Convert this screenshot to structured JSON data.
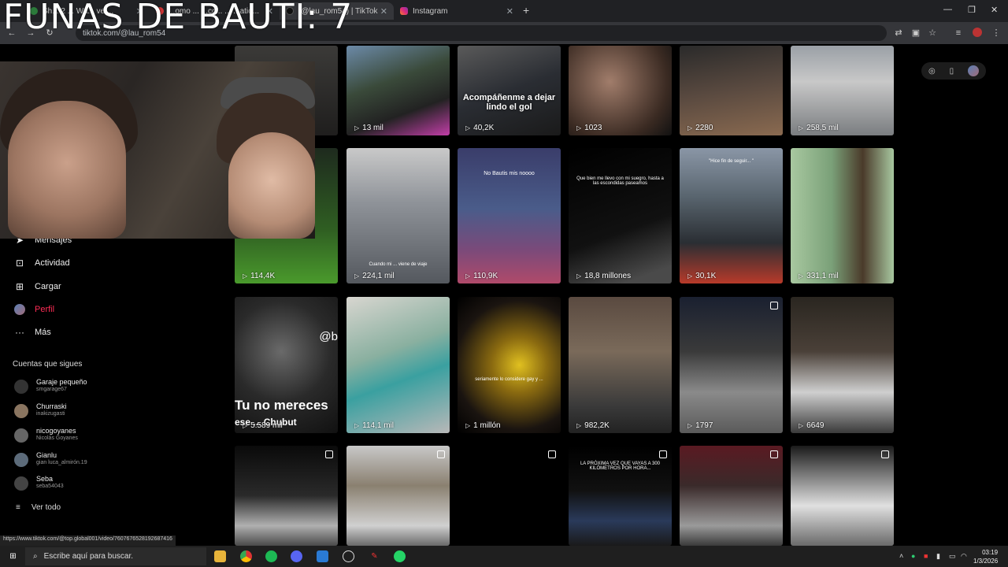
{
  "overlay": {
    "title": "FUNAS DE BAUTI: 7"
  },
  "browser": {
    "tabs": [
      {
        "label": "Sh... 2 ... Wa... ve ..."
      },
      {
        "label": "...omo ... ...cc... ... ...atio..."
      },
      {
        "label": "(@lau_rom54) | TikTok"
      },
      {
        "label": "Instagram"
      }
    ],
    "url": "tiktok.com/@lau_rom54",
    "new_tab": "+"
  },
  "sidebar": {
    "items": [
      {
        "label": "Mensajes",
        "icon": "send-icon"
      },
      {
        "label": "Actividad",
        "icon": "inbox-icon"
      },
      {
        "label": "Cargar",
        "icon": "upload-icon"
      },
      {
        "label": "Perfil",
        "icon": "profile-avatar"
      },
      {
        "label": "Más",
        "icon": "more-icon"
      }
    ],
    "following_title": "Cuentas que sigues",
    "following": [
      {
        "name": "Garaje pequeño",
        "handle": "smgarage67"
      },
      {
        "name": "Churraski",
        "handle": "inakizugasti"
      },
      {
        "name": "nicogoyanes",
        "handle": "Nicolás Goyanes"
      },
      {
        "name": "Gianlu",
        "handle": "gian luca_almirón.19"
      },
      {
        "name": "Seba",
        "handle": "seba54043"
      }
    ],
    "see_all": "Ver todo"
  },
  "grid": {
    "row1": [
      {
        "count": ""
      },
      {
        "count": "13 mil"
      },
      {
        "count": "40,2K",
        "caption": "Acompáñenme a dejar lindo el gol"
      },
      {
        "count": "1023"
      },
      {
        "count": "2280"
      },
      {
        "count": "258,5 mil"
      }
    ],
    "row2": [
      {
        "count": "114,4K"
      },
      {
        "count": "224,1 mil",
        "caption": "Cuando mi ... viene de viaje"
      },
      {
        "count": "110,9K",
        "caption": "No Bautis mis noooo"
      },
      {
        "count": "18,8 millones",
        "caption": "Que bien me llevo con mi suegro, hasta a las escondidas paseamos"
      },
      {
        "count": "30,1K",
        "caption": "\"Hice fin de seguir... \""
      },
      {
        "count": "331,1 mil"
      }
    ],
    "row3": [
      {
        "count": "5.589 mil",
        "big_text": "Tu no mereces",
        "big_text2": "ese ... Chubut",
        "tag": "@b"
      },
      {
        "count": "114,1 mil"
      },
      {
        "count": "1 millón",
        "caption": "seriamente lo considere gay y ..."
      },
      {
        "count": "982,2K"
      },
      {
        "count": "1797"
      },
      {
        "count": "6649"
      }
    ],
    "row4": [
      {
        "count": ""
      },
      {
        "count": ""
      },
      {
        "count": ""
      },
      {
        "count": "",
        "caption": "LA PRÓXIMA VEZ QUE VAYAS A 300 KILÓMETROS POR HORA..."
      },
      {
        "count": ""
      },
      {
        "count": ""
      }
    ]
  },
  "status_url": "https://www.tiktok.com/@top.global001/video/7607676528192687416",
  "taskbar": {
    "search_placeholder": "Escribe aquí para buscar.",
    "time": "03:19",
    "date": "1/3/2026"
  }
}
